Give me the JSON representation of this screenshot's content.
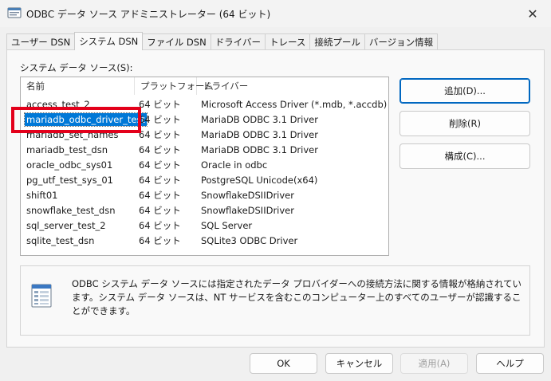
{
  "window": {
    "title": "ODBC データ ソース アドミニストレーター (64 ビット)",
    "close_glyph": "✕"
  },
  "tabs": [
    {
      "label": "ユーザー DSN"
    },
    {
      "label": "システム DSN"
    },
    {
      "label": "ファイル DSN"
    },
    {
      "label": "ドライバー"
    },
    {
      "label": "トレース"
    },
    {
      "label": "接続プール"
    },
    {
      "label": "バージョン情報"
    }
  ],
  "active_tab": "システム DSN",
  "section_label": "システム データ ソース(S):",
  "table": {
    "columns": [
      "名前",
      "プラットフォーム",
      "ドライバー"
    ],
    "rows": [
      {
        "name": "access_test_2",
        "platform": "64 ビット",
        "driver": "Microsoft Access Driver (*.mdb, *.accdb)"
      },
      {
        "name": "mariadb_odbc_driver_test",
        "platform": "64 ビット",
        "driver": "MariaDB ODBC 3.1 Driver"
      },
      {
        "name": "mariadb_set_names",
        "platform": "64 ビット",
        "driver": "MariaDB ODBC 3.1 Driver"
      },
      {
        "name": "mariadb_test_dsn",
        "platform": "64 ビット",
        "driver": "MariaDB ODBC 3.1 Driver"
      },
      {
        "name": "oracle_odbc_sys01",
        "platform": "64 ビット",
        "driver": "Oracle in odbc"
      },
      {
        "name": "pg_utf_test_sys_01",
        "platform": "64 ビット",
        "driver": "PostgreSQL Unicode(x64)"
      },
      {
        "name": "shift01",
        "platform": "64 ビット",
        "driver": "SnowflakeDSIIDriver"
      },
      {
        "name": "snowflake_test_dsn",
        "platform": "64 ビット",
        "driver": "SnowflakeDSIIDriver"
      },
      {
        "name": "sql_server_test_2",
        "platform": "64 ビット",
        "driver": "SQL Server"
      },
      {
        "name": "sqlite_test_dsn",
        "platform": "64 ビット",
        "driver": "SQLite3 ODBC Driver"
      }
    ],
    "selected_row": "mariadb_odbc_driver_test"
  },
  "side_buttons": {
    "add": "追加(D)...",
    "remove": "削除(R)",
    "configure": "構成(C)..."
  },
  "info_text": "ODBC システム データ ソースには指定されたデータ プロバイダーへの接続方法に関する情報が格納されています。システム データ ソースは、NT サービスを含むこのコンピューター上のすべてのユーザーが認識することができます。",
  "bottom_buttons": {
    "ok": "OK",
    "cancel": "キャンセル",
    "apply": "適用(A)",
    "help": "ヘルプ"
  },
  "colors": {
    "selection": "#0078d7",
    "highlight_box": "#e3001b",
    "primary_border": "#0067c0"
  }
}
